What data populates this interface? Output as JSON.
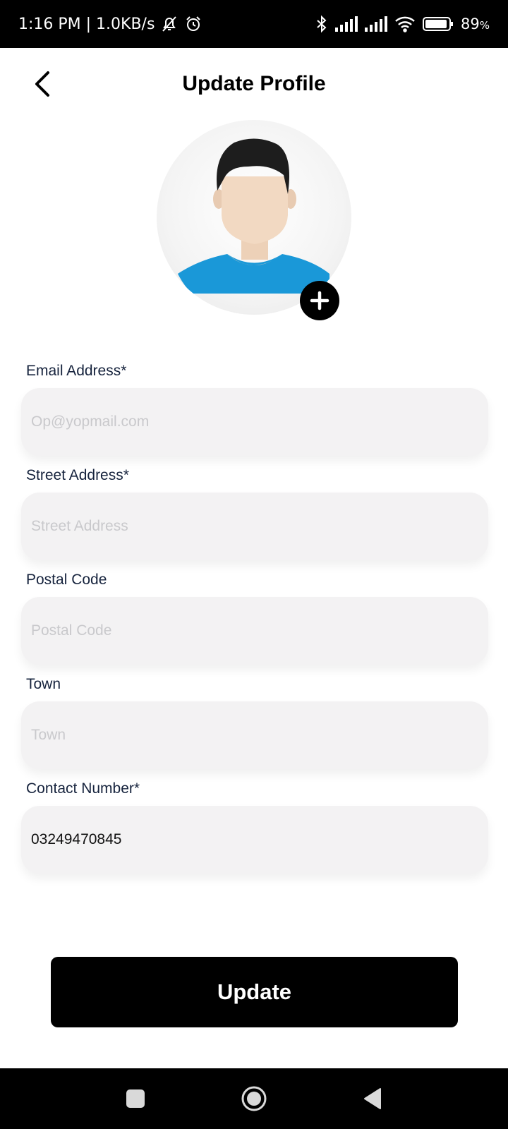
{
  "status_bar": {
    "time_speed": "1:16 PM | 1.0KB/s",
    "battery_level": "89",
    "battery_unit": "%",
    "icons": [
      "bell-off-icon",
      "alarm-icon",
      "bluetooth-icon",
      "signal-icon",
      "signal-icon",
      "wifi-icon",
      "battery-icon"
    ]
  },
  "header": {
    "title": "Update Profile",
    "back_icon": "chevron-left-icon"
  },
  "avatar": {
    "add_icon": "plus-icon"
  },
  "form": {
    "email": {
      "label": "Email Address*",
      "placeholder": "Op@yopmail.com"
    },
    "street": {
      "label": "Street Address*",
      "placeholder": "Street Address"
    },
    "postal": {
      "label": "Postal Code",
      "placeholder": "Postal Code"
    },
    "town": {
      "label": "Town",
      "placeholder": "Town"
    },
    "contact": {
      "label": "Contact Number*",
      "value": "03249470845"
    }
  },
  "actions": {
    "update_label": "Update"
  },
  "nav": {
    "icons": [
      "recents-square-icon",
      "home-circle-icon",
      "back-triangle-icon"
    ]
  },
  "colors": {
    "primary": "#000000",
    "field_bg": "#f3f2f3",
    "label": "#16233d",
    "shirt": "#1a98d8"
  }
}
